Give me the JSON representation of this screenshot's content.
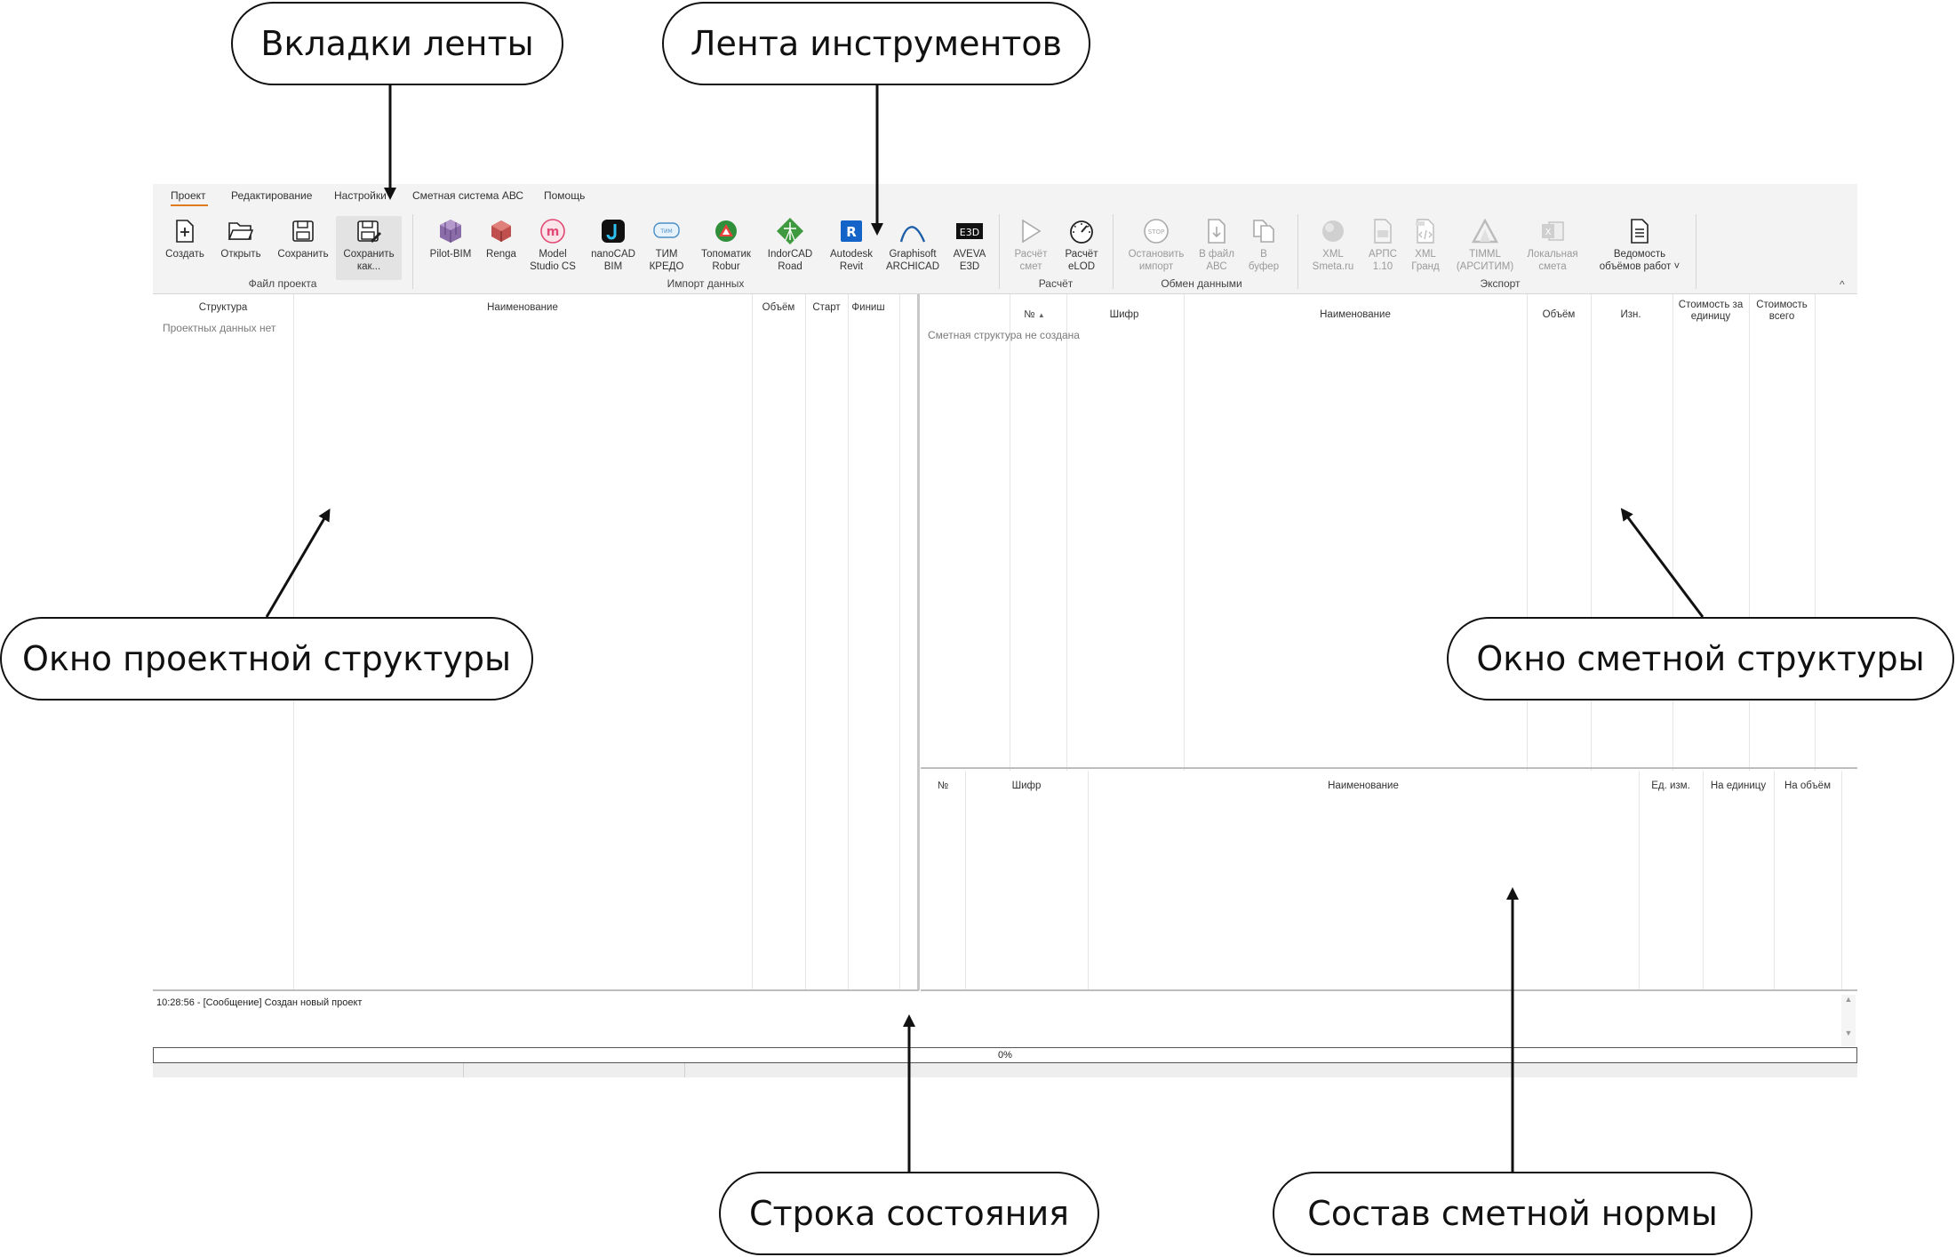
{
  "callouts": {
    "ribbon_tabs": "Вкладки ленты",
    "ribbon_tools": "Лента инструментов",
    "project_window": "Окно проектной структуры",
    "estimate_window": "Окно сметной структуры",
    "status_bar": "Строка состояния",
    "norm_composition": "Состав сметной нормы"
  },
  "tabs": [
    "Проект",
    "Редактирование",
    "Настройки",
    "Сметная система АВС",
    "Помощь"
  ],
  "ribbon": {
    "file": {
      "group_label": "Файл проекта",
      "create": "Создать",
      "open": "Открыть",
      "save": "Сохранить",
      "save_as_1": "Сохранить",
      "save_as_2": "как..."
    },
    "import": {
      "group_label": "Импорт данных",
      "pilot": "Pilot-BIM",
      "renga": "Renga",
      "model_1": "Model",
      "model_2": "Studio CS",
      "nano_1": "nanoCAD",
      "nano_2": "BIM",
      "tim_1": "ТИМ",
      "tim_2": "КРЕДО",
      "topo_1": "Топоматик",
      "topo_2": "Robur",
      "indor_1": "IndorCAD",
      "indor_2": "Road",
      "revit_1": "Autodesk",
      "revit_2": "Revit",
      "archicad_1": "Graphisoft",
      "archicad_2": "ARCHICAD",
      "aveva_1": "AVEVA",
      "aveva_2": "E3D"
    },
    "calc": {
      "group_label": "Расчёт",
      "calc_1": "Расчёт",
      "calc_2": "смет",
      "elod_1": "Расчёт",
      "elod_2": "eLOD"
    },
    "exchange": {
      "group_label": "Обмен данными",
      "stop_1": "Остановить",
      "stop_2": "импорт",
      "tofile_1": "В файл",
      "tofile_2": "АВС",
      "buffer_1": "В",
      "buffer_2": "буфер"
    },
    "export": {
      "group_label": "Экспорт",
      "xmlsmeta_1": "XML",
      "xmlsmeta_2": "Smeta.ru",
      "arps_1": "АРПС",
      "arps_2": "1.10",
      "xmlgrand_1": "XML",
      "xmlgrand_2": "Гранд",
      "timml_1": "TIMML",
      "timml_2": "(АРСИТИМ)",
      "local_1": "Локальная",
      "local_2": "смета",
      "vedom_1": "Ведомость",
      "vedom_2": "объёмов работ ˅"
    }
  },
  "project_pane": {
    "headers": [
      "Структура",
      "Наименование",
      "Объём",
      "Старт",
      "Финиш"
    ],
    "empty": "Проектных данных нет"
  },
  "estimate_pane": {
    "headers": [
      "№",
      "Шифр",
      "Наименование",
      "Объём",
      "Изн.",
      "Стоимость за",
      "единицу",
      "Стоимость",
      "всего"
    ],
    "empty": "Сметная структура не создана"
  },
  "norm_pane": {
    "headers": [
      "№",
      "Шифр",
      "Наименование",
      "Ед. изм.",
      "На единицу",
      "На объём"
    ]
  },
  "log": {
    "message": "10:28:56 - [Сообщение] Создан новый проект"
  },
  "progress": {
    "label": "0%",
    "value": 0
  },
  "colors": {
    "accent": "#e07a1f",
    "ribbon_bg": "#f3f3f3"
  }
}
